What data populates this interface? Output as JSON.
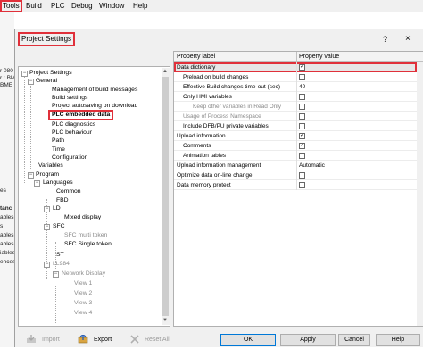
{
  "menu": {
    "items": [
      "Tools",
      "Build",
      "PLC",
      "Debug",
      "Window",
      "Help"
    ]
  },
  "background": {
    "lines": [
      "r 080",
      "r : BM",
      "BME",
      "es",
      "tanc",
      "ables",
      "s",
      "ables",
      "ables",
      "iables",
      "ences"
    ]
  },
  "dialog": {
    "title": "Project Settings",
    "help": "?",
    "close": "×"
  },
  "tree": {
    "items": [
      "Project Settings",
      "General",
      "Management of build messages",
      "Build settings",
      "Project autosaving on download",
      "PLC embedded data",
      "PLC diagnostics",
      "PLC behaviour",
      "Path",
      "Time",
      "Configuration",
      "Variables",
      "Program",
      "Languages",
      "Common",
      "FBD",
      "LD",
      "Mixed display",
      "SFC",
      "SFC multi token",
      "SFC Single token",
      "ST",
      "LL984",
      "Network Display",
      "View 1",
      "View 2",
      "View 3",
      "View 4"
    ],
    "expanders": [
      "−",
      "−",
      "−",
      "−",
      "−",
      "−",
      "−",
      "−"
    ]
  },
  "grid": {
    "header_label": "Property label",
    "header_value": "Property value",
    "rows": [
      {
        "label": "Data dictionary",
        "value": "",
        "checked": true,
        "checkbox": true
      },
      {
        "label": "Preload on build changes",
        "value": "",
        "checked": false,
        "checkbox": true
      },
      {
        "label": "Effective Build changes time-out (sec)",
        "value": "40",
        "checked": false,
        "checkbox": false
      },
      {
        "label": "Only HMI variables",
        "value": "",
        "checked": false,
        "checkbox": true
      },
      {
        "label": "Keep other variables in Read Only",
        "value": "",
        "checked": false,
        "checkbox": true
      },
      {
        "label": "Usage of Process Namespace",
        "value": "",
        "checked": false,
        "checkbox": true
      },
      {
        "label": "Include DFB/PU private variables",
        "value": "",
        "checked": false,
        "checkbox": true
      },
      {
        "label": "Upload information",
        "value": "",
        "checked": true,
        "checkbox": true
      },
      {
        "label": "Comments",
        "value": "",
        "checked": true,
        "checkbox": true
      },
      {
        "label": "Animation tables",
        "value": "",
        "checked": false,
        "checkbox": true
      },
      {
        "label": "Upload information management",
        "value": "Automatic",
        "checked": false,
        "checkbox": false
      },
      {
        "label": "Optimize data on-line change",
        "value": "",
        "checked": false,
        "checkbox": true
      },
      {
        "label": "Data memory protect",
        "value": "",
        "checked": false,
        "checkbox": true
      }
    ],
    "check_glyph": "✓"
  },
  "footer": {
    "import": "Import",
    "export": "Export",
    "reset_all": "Reset All",
    "ok": "OK",
    "apply": "Apply",
    "cancel": "Cancel",
    "help": "Help"
  },
  "colors": {
    "highlight": "#e0303a",
    "selection_border": "#0078d7"
  }
}
